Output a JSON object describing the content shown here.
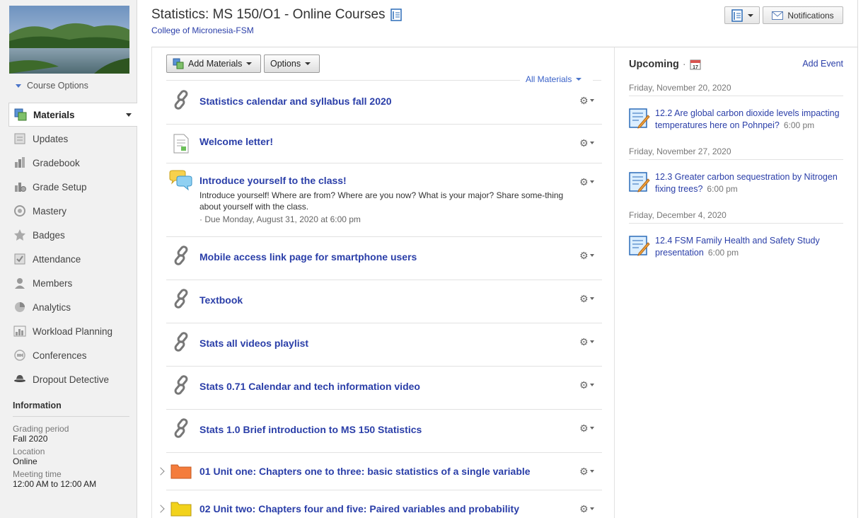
{
  "course": {
    "title": "Statistics: MS 150/O1 - Online Courses",
    "school": "College of Micronesia-FSM",
    "options_label": "Course Options"
  },
  "header": {
    "notifications_label": "Notifications"
  },
  "sidebar": {
    "items": [
      {
        "label": "Materials",
        "icon": "materials-icon",
        "active": true
      },
      {
        "label": "Updates",
        "icon": "updates-icon"
      },
      {
        "label": "Gradebook",
        "icon": "gradebook-icon"
      },
      {
        "label": "Grade Setup",
        "icon": "grade-setup-icon"
      },
      {
        "label": "Mastery",
        "icon": "mastery-icon"
      },
      {
        "label": "Badges",
        "icon": "badges-icon"
      },
      {
        "label": "Attendance",
        "icon": "attendance-icon"
      },
      {
        "label": "Members",
        "icon": "members-icon"
      },
      {
        "label": "Analytics",
        "icon": "analytics-icon"
      },
      {
        "label": "Workload Planning",
        "icon": "workload-icon"
      },
      {
        "label": "Conferences",
        "icon": "conferences-icon"
      },
      {
        "label": "Dropout Detective",
        "icon": "dropout-detective-icon"
      }
    ],
    "info": {
      "heading": "Information",
      "grading_period_label": "Grading period",
      "grading_period": "Fall 2020",
      "location_label": "Location",
      "location": "Online",
      "meeting_time_label": "Meeting time",
      "meeting_time": "12:00 AM to 12:00 AM"
    }
  },
  "toolbar": {
    "add_materials": "Add Materials",
    "options": "Options",
    "filter": "All Materials"
  },
  "materials": [
    {
      "type": "link",
      "title": "Statistics calendar and syllabus fall 2020"
    },
    {
      "type": "page",
      "title": "Welcome letter!"
    },
    {
      "type": "discussion",
      "title": "Introduce yourself to the class!",
      "description": "Introduce yourself! Where are from? Where are you now? What is your major? Share some-thing about yourself with the class.",
      "due": "· Due Monday, August 31, 2020 at 6:00 pm"
    },
    {
      "type": "link",
      "title": "Mobile access link page for smartphone users"
    },
    {
      "type": "link",
      "title": "Textbook"
    },
    {
      "type": "link",
      "title": "Stats all videos playlist"
    },
    {
      "type": "link",
      "title": "Stats 0.71 Calendar and tech information video"
    },
    {
      "type": "link",
      "title": "Stats 1.0 Brief introduction to MS 150 Statistics"
    },
    {
      "type": "folder",
      "color": "#f47c3c",
      "title": "01 Unit one: Chapters one to three: basic statistics of a single variable"
    },
    {
      "type": "folder",
      "color": "#f2d21b",
      "title": "02 Unit two: Chapters four and five: Paired variables and probability"
    }
  ],
  "upcoming": {
    "title": "Upcoming",
    "add_event": "Add Event",
    "calendar_day": "17",
    "groups": [
      {
        "date": "Friday, November 20, 2020",
        "event": "12.2 Are global carbon dioxide levels impacting temperatures here on Pohnpei?",
        "time": "6:00 pm"
      },
      {
        "date": "Friday, November 27, 2020",
        "event": "12.3 Greater carbon sequestration by Nitrogen fixing trees?",
        "time": "6:00 pm"
      },
      {
        "date": "Friday, December 4, 2020",
        "event": "12.4 FSM Family Health and Safety Study presentation",
        "time": "6:00 pm"
      }
    ]
  }
}
